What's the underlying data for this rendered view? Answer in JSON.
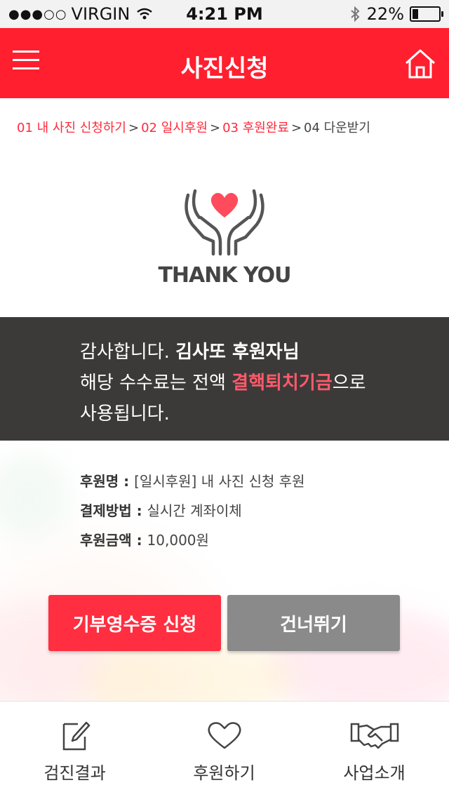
{
  "status": {
    "carrier": "VIRGIN",
    "signal_dots": "●●●○○",
    "time": "4:21 PM",
    "battery": "22%",
    "battery_level": 0.22
  },
  "header": {
    "title": "사진신청",
    "menu_icon": "menu-icon",
    "home_icon": "home-icon",
    "color": "#ff1f2f"
  },
  "breadcrumb": {
    "step1": "01 내 사진 신청하기",
    "step2": "02 일시후원",
    "step3": "03 후원완료",
    "step4": "04 다운받기",
    "separator": ">"
  },
  "thanks": {
    "icon": "hands-heart-icon",
    "text": "THANK YOU"
  },
  "message": {
    "line1_a": "감사합니다. ",
    "line1_b": "김사또 후원자님",
    "line2_a": "해당 수수료는 전액 ",
    "line2_b": "결핵퇴치기금",
    "line2_c": "으로",
    "line3": "사용됩니다."
  },
  "info": {
    "name_label": "후원명 : ",
    "name_value": "[일시후원] 내 사진 신청 후원",
    "method_label": "결제방법 : ",
    "method_value": "실시간 계좌이체",
    "amount_label": "후원금액 : ",
    "amount_value": "10,000원"
  },
  "buttons": {
    "receipt": "기부영수증 신청",
    "skip": "건너뛰기"
  },
  "tabs": [
    {
      "label": "검진결과",
      "icon": "edit-document-icon"
    },
    {
      "label": "후원하기",
      "icon": "heart-icon"
    },
    {
      "label": "사업소개",
      "icon": "handshake-icon"
    }
  ]
}
